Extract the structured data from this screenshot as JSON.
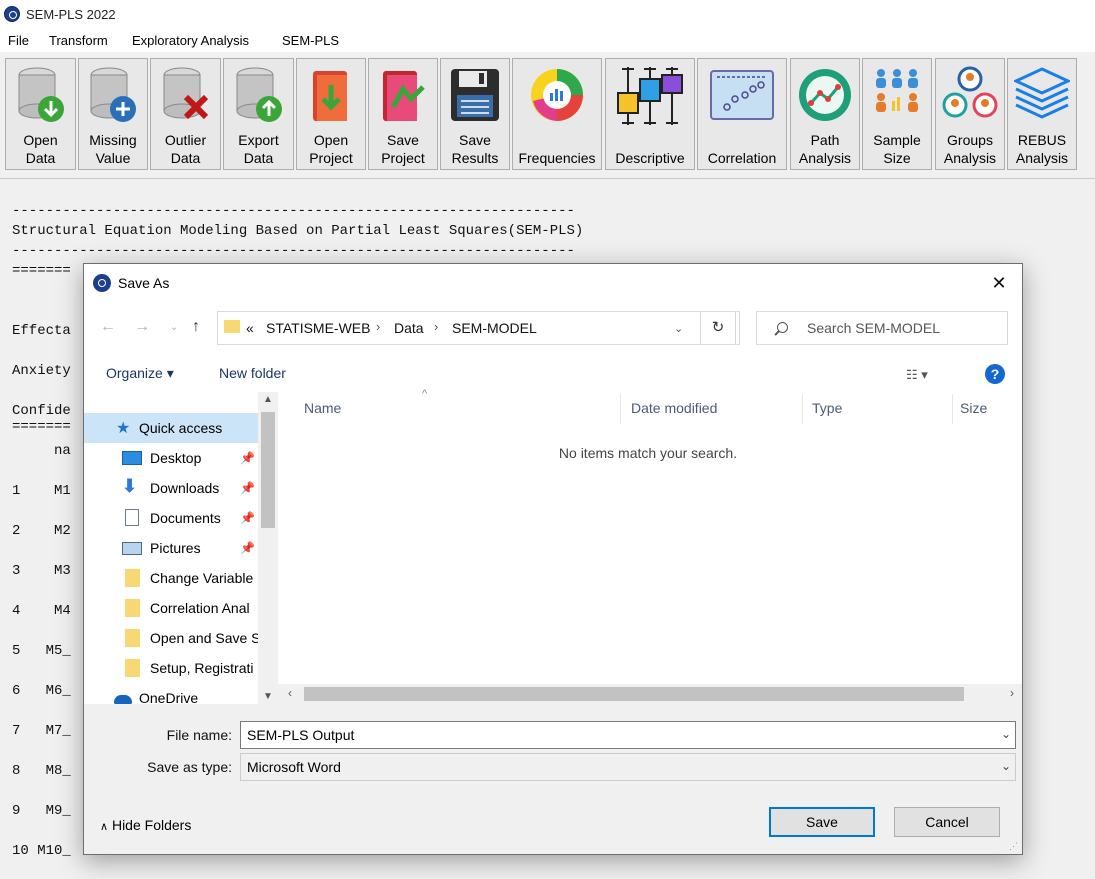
{
  "app": {
    "title": "SEM-PLS 2022",
    "menu": [
      "File",
      "Transform",
      "Exploratory Analysis",
      "SEM-PLS"
    ]
  },
  "toolbar": {
    "buttons": [
      {
        "label": "Open\nData",
        "icon": "database-down-icon"
      },
      {
        "label": "Missing\nValue",
        "icon": "database-plus-icon"
      },
      {
        "label": "Outlier\nData",
        "icon": "database-x-icon"
      },
      {
        "label": "Export\nData",
        "icon": "database-up-icon"
      },
      {
        "label": "Open\nProject",
        "icon": "folder-open-icon"
      },
      {
        "label": "Save\nProject",
        "icon": "folder-save-icon"
      },
      {
        "label": "Save\nResults",
        "icon": "floppy-disk-icon"
      },
      {
        "label": "Frequencies",
        "icon": "pie-chart-icon"
      },
      {
        "label": "Descriptive",
        "icon": "boxplot-icon"
      },
      {
        "label": "Correlation",
        "icon": "scatter-icon"
      },
      {
        "label": "Path\nAnalysis",
        "icon": "path-chart-icon"
      },
      {
        "label": "Sample\nSize",
        "icon": "people-grid-icon"
      },
      {
        "label": "Groups\nAnalysis",
        "icon": "groups-icon"
      },
      {
        "label": "REBUS\nAnalysis",
        "icon": "layers-icon"
      }
    ]
  },
  "output": {
    "lines": [
      "-------------------------------------------------------------------",
      "Structural Equation Modeling Based on Partial Least Squares(SEM-PLS)",
      "-------------------------------------------------------------------",
      "=======",
      "Effecta",
      "Anxiety",
      "Confide",
      "=======",
      "     na",
      "1    M1",
      "2    M2",
      "3    M3",
      "4    M4",
      "5   M5_",
      "6   M6_",
      "7   M7_",
      "8   M8_",
      "9   M9_",
      "10 M10_"
    ]
  },
  "dialog": {
    "title": "Save As",
    "close": "✕",
    "breadcrumb": [
      "«",
      "STATISME-WEB",
      "Data",
      "SEM-MODEL"
    ],
    "search_placeholder": "Search SEM-MODEL",
    "organize": "Organize ▾",
    "new_folder": "New folder",
    "help": "?",
    "nav_items": [
      {
        "label": "Quick access",
        "icon": "star-icon",
        "pinned": false,
        "selected": true
      },
      {
        "label": "Desktop",
        "icon": "desktop-icon",
        "pinned": true
      },
      {
        "label": "Downloads",
        "icon": "download-arrow-icon",
        "pinned": true
      },
      {
        "label": "Documents",
        "icon": "document-icon",
        "pinned": true
      },
      {
        "label": "Pictures",
        "icon": "pictures-icon",
        "pinned": true
      },
      {
        "label": "Change Variable",
        "icon": "folder-icon",
        "pinned": false
      },
      {
        "label": "Correlation Anal",
        "icon": "folder-icon",
        "pinned": false
      },
      {
        "label": "Open and Save S",
        "icon": "folder-icon",
        "pinned": false
      },
      {
        "label": "Setup, Registrati",
        "icon": "folder-icon",
        "pinned": false
      },
      {
        "label": "OneDrive",
        "icon": "cloud-icon",
        "pinned": false
      }
    ],
    "columns": [
      "Name",
      "Date modified",
      "Type",
      "Size"
    ],
    "empty_message": "No items match your search.",
    "file_name_label": "File name:",
    "file_name_value": "SEM-PLS Output",
    "save_type_label": "Save as type:",
    "save_type_value": "Microsoft Word",
    "hide_folders": "Hide Folders",
    "save_button": "Save",
    "cancel_button": "Cancel"
  },
  "colors": {
    "accent": "#0078d7",
    "selection": "#cce4f7",
    "folder": "#f8d775"
  }
}
